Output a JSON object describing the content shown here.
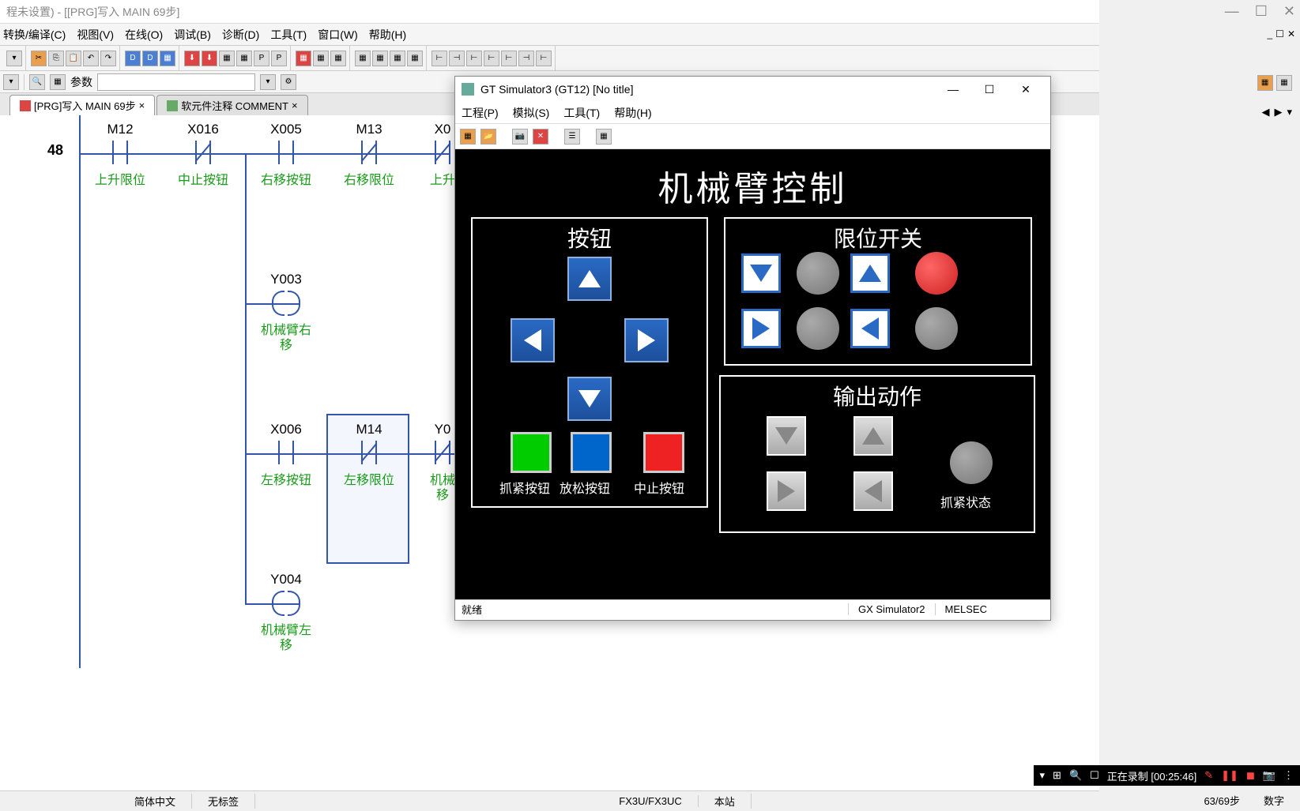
{
  "main": {
    "title": "程未设置) - [[PRG]写入 MAIN 69步]",
    "menu": {
      "convert": "转换/编译(C)",
      "view": "视图(V)",
      "online": "在线(O)",
      "debug": "调试(B)",
      "diagnose": "诊断(D)",
      "tools": "工具(T)",
      "window": "窗口(W)",
      "help": "帮助(H)"
    },
    "toolbar2": {
      "param": "参数"
    },
    "tabs": {
      "prg": "[PRG]写入 MAIN 69步",
      "comment": "软元件注释 COMMENT"
    }
  },
  "ladder": {
    "step": "48",
    "contacts": {
      "m12": {
        "label": "M12",
        "comment": "上升限位"
      },
      "x016": {
        "label": "X016",
        "comment": "中止按钮"
      },
      "x005": {
        "label": "X005",
        "comment": "右移按钮"
      },
      "m13": {
        "label": "M13",
        "comment": "右移限位"
      },
      "x0a": {
        "label": "X0",
        "comment": "上升"
      },
      "x006": {
        "label": "X006",
        "comment": "左移按钮"
      },
      "m14": {
        "label": "M14",
        "comment": "左移限位"
      },
      "y0a": {
        "label": "Y0",
        "comment": "机械\n移"
      }
    },
    "coils": {
      "y003": {
        "label": "Y003",
        "comment": "机械臂右\n移"
      },
      "y004": {
        "label": "Y004",
        "comment": "机械臂左\n移"
      }
    }
  },
  "statusbar": {
    "lang": "简体中文",
    "label": "无标签",
    "plc": "FX3U/FX3UC",
    "station": "本站",
    "steps": "63/69步",
    "num": "数字"
  },
  "gt": {
    "title": "GT Simulator3 (GT12)   [No title]",
    "menu": {
      "project": "工程(P)",
      "sim": "模拟(S)",
      "tools": "工具(T)",
      "help": "帮助(H)"
    },
    "status": {
      "ready": "就绪",
      "sim": "GX Simulator2",
      "melsec": "MELSEC"
    }
  },
  "hmi": {
    "title": "机械臂控制",
    "panels": {
      "buttons": "按钮",
      "limits": "限位开关",
      "outputs": "输出动作"
    },
    "labels": {
      "grip": "抓紧按钮",
      "release": "放松按钮",
      "stop": "中止按钮",
      "grip_state": "抓紧状态"
    }
  },
  "rec": {
    "text": "正在录制 [00:25:46]"
  }
}
